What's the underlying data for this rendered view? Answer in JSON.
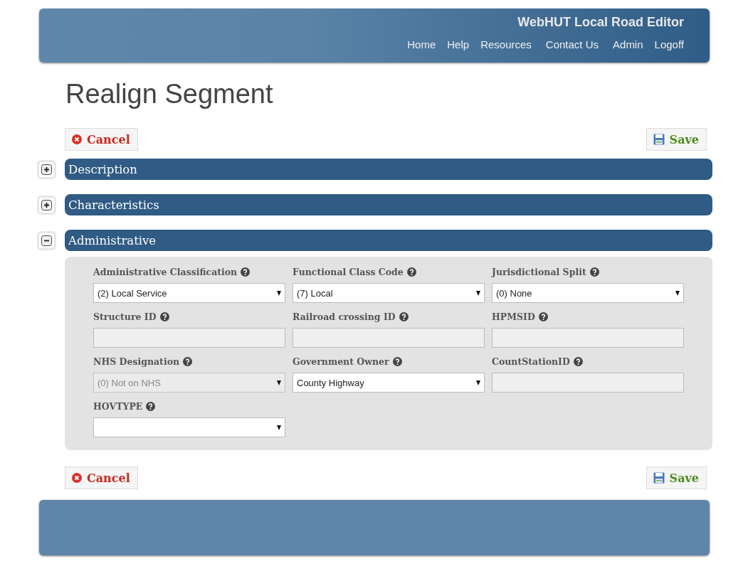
{
  "header": {
    "title": "WebHUT Local Road Editor",
    "nav": [
      "Home",
      "Help",
      "Resources",
      "Contact Us",
      "Admin",
      "Logoff"
    ]
  },
  "page_title": "Realign Segment",
  "actions_top": {
    "cancel": "Cancel",
    "save": "Save"
  },
  "sections": [
    {
      "title": "Description",
      "expanded": false
    },
    {
      "title": "Characteristics",
      "expanded": false
    },
    {
      "title": "Administrative",
      "expanded": true,
      "fields": [
        {
          "label": "Administrative Classification",
          "kind": "select",
          "value": "(2) Local Service",
          "disabled": false
        },
        {
          "label": "Functional Class Code",
          "kind": "select",
          "value": "(7) Local",
          "disabled": false
        },
        {
          "label": "Jurisdictional Split",
          "kind": "select",
          "value": "(0) None",
          "disabled": false
        },
        {
          "label": "Structure ID",
          "kind": "text"
        },
        {
          "label": "Railroad crossing ID",
          "kind": "text"
        },
        {
          "label": "HPMSID",
          "kind": "text"
        },
        {
          "label": "NHS Designation",
          "kind": "select",
          "value": "(0) Not on NHS",
          "disabled": true
        },
        {
          "label": "Government Owner",
          "kind": "select",
          "value": "County Highway",
          "disabled": false
        },
        {
          "label": "CountStationID",
          "kind": "text"
        },
        {
          "label": "HOVTYPE",
          "kind": "select",
          "disabled": false
        }
      ]
    }
  ],
  "actions_bottom": {
    "cancel": "Cancel",
    "save": "Save"
  }
}
